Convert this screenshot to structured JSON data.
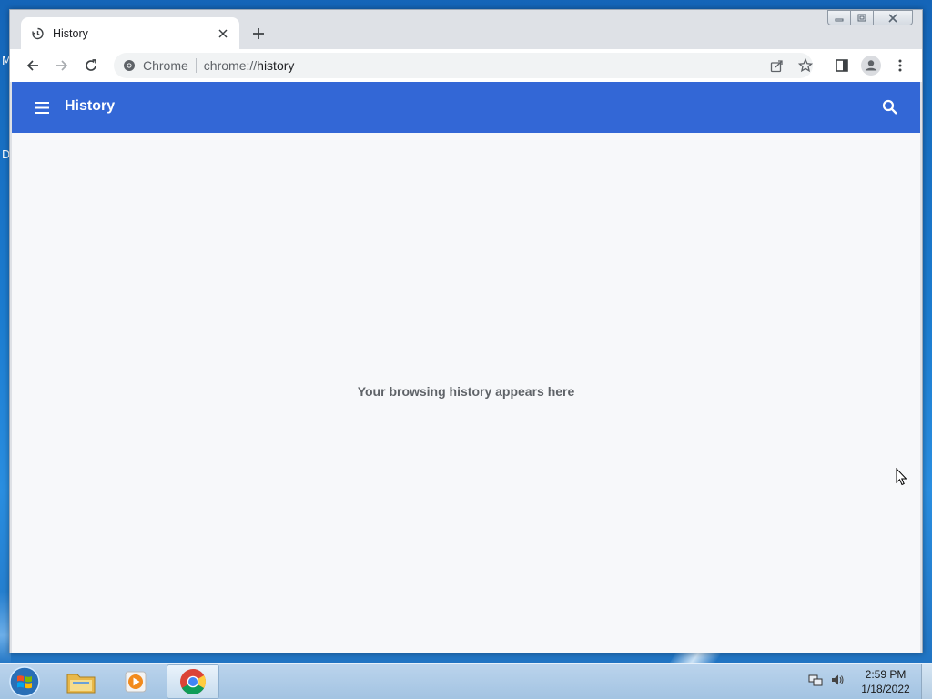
{
  "desktop": {
    "edge_text_top": "M",
    "edge_text_mid": "D"
  },
  "browser": {
    "tab": {
      "title": "History",
      "icon": "history-icon"
    },
    "window_controls": [
      "minimize",
      "restore",
      "close"
    ],
    "toolbar": {
      "site_chip": "Chrome",
      "url_scheme": "chrome://",
      "url_host": "history",
      "icons": [
        "back-icon",
        "forward-icon",
        "reload-icon",
        "share-icon",
        "star-icon",
        "side-panel-icon",
        "profile-icon",
        "menu-icon"
      ]
    }
  },
  "page": {
    "header_title": "History",
    "empty_message": "Your browsing history appears here",
    "header_color": "#3367d6"
  },
  "taskbar": {
    "items": [
      "windows-explorer",
      "media-player",
      "chrome"
    ],
    "clock_time": "2:59 PM",
    "clock_date": "1/18/2022"
  }
}
